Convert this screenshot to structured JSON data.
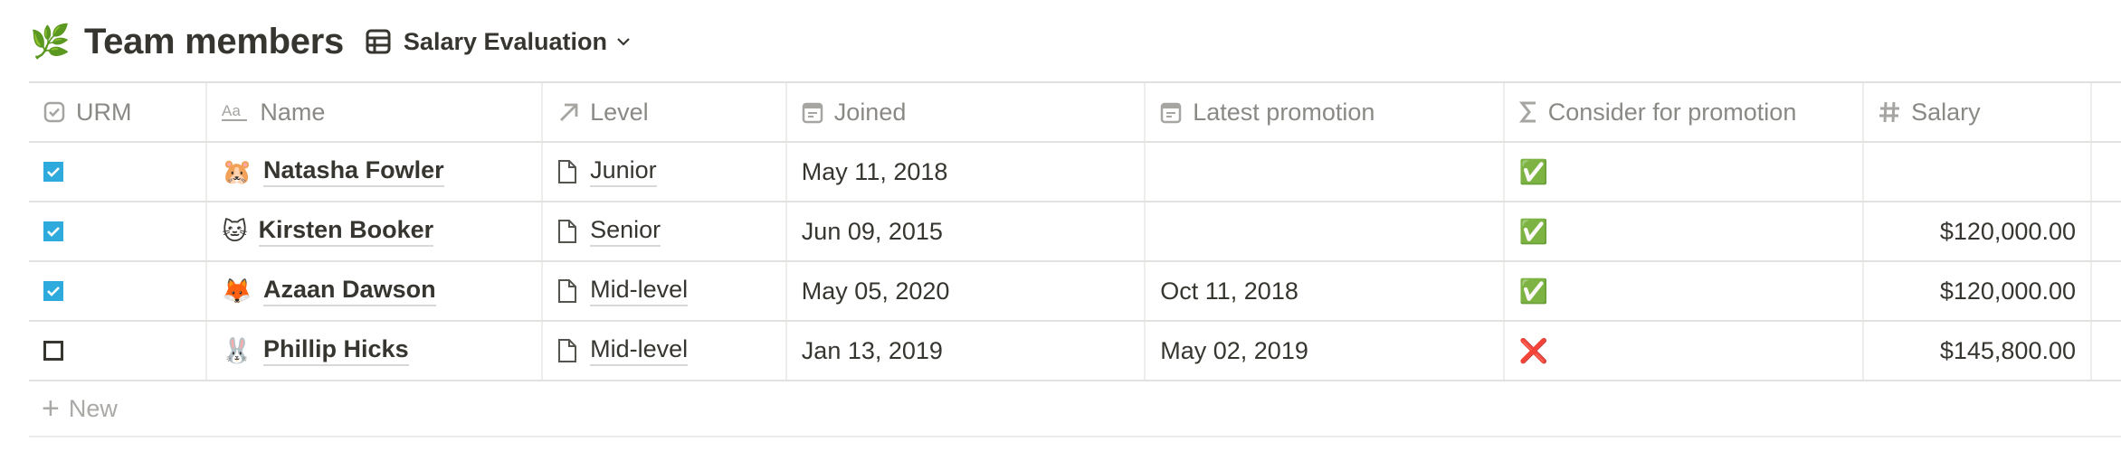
{
  "header": {
    "icon": "herb-emoji",
    "icon_glyph": "🌿",
    "title": "Team members",
    "view": {
      "icon": "table-icon",
      "label": "Salary Evaluation",
      "dropdown_icon": "chevron-down-icon"
    }
  },
  "table": {
    "columns": [
      {
        "key": "urm",
        "label": "URM",
        "icon": "checkbox-property-icon"
      },
      {
        "key": "name",
        "label": "Name",
        "icon": "text-title-icon"
      },
      {
        "key": "level",
        "label": "Level",
        "icon": "relation-arrow-icon"
      },
      {
        "key": "joined",
        "label": "Joined",
        "icon": "calendar-icon"
      },
      {
        "key": "latest_promotion",
        "label": "Latest promotion",
        "icon": "calendar-icon"
      },
      {
        "key": "consider",
        "label": "Consider for promotion",
        "icon": "sigma-formula-icon"
      },
      {
        "key": "salary",
        "label": "Salary",
        "icon": "number-hash-icon"
      }
    ],
    "rows": [
      {
        "urm": true,
        "emoji": "🐹",
        "name": "Natasha Fowler",
        "level": "Junior",
        "joined": "May 11, 2018",
        "latest_promotion": "",
        "consider": "✅",
        "salary": ""
      },
      {
        "urm": true,
        "emoji": "🐱",
        "name": "Kirsten Booker",
        "level": "Senior",
        "joined": "Jun 09, 2015",
        "latest_promotion": "",
        "consider": "✅",
        "salary": "$120,000.00"
      },
      {
        "urm": true,
        "emoji": "🦊",
        "name": "Azaan Dawson",
        "level": "Mid-level",
        "joined": "May 05, 2020",
        "latest_promotion": "Oct 11, 2018",
        "consider": "✅",
        "salary": "$120,000.00"
      },
      {
        "urm": false,
        "emoji": "🐰",
        "name": "Phillip Hicks",
        "level": "Mid-level",
        "joined": "Jan 13, 2019",
        "latest_promotion": "May 02, 2019",
        "consider": "❌",
        "salary": "$145,800.00"
      }
    ],
    "new_label": "New"
  },
  "colors": {
    "text": "#37352F",
    "muted": "#8a8985",
    "checkbox_on": "#2eaadc",
    "border": "#e3e2e0"
  }
}
